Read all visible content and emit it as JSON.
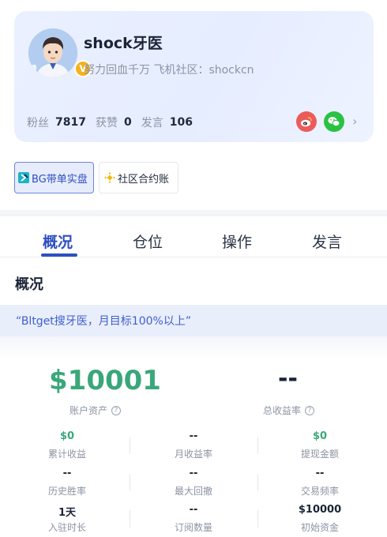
{
  "profile": {
    "username": "shock牙医",
    "bio": "努力回血千万 飞机社区：shockcn",
    "vip_badge": "V",
    "stats": [
      {
        "label": "粉丝",
        "value": "7817"
      },
      {
        "label": "获赞",
        "value": "0"
      },
      {
        "label": "发言",
        "value": "106"
      }
    ],
    "social_icons": [
      "weibo-icon",
      "wechat-icon"
    ]
  },
  "tags": {
    "bg_label": "BG带单实盘",
    "community_label": "社区合约账"
  },
  "tabs": [
    {
      "label": "概况",
      "active": true
    },
    {
      "label": "仓位",
      "active": false
    },
    {
      "label": "操作",
      "active": false
    },
    {
      "label": "发言",
      "active": false
    }
  ],
  "overview": {
    "title": "概况",
    "quote": "“Bltget搜牙医，月目标100%以上”",
    "account_asset_value": "$10001",
    "account_asset_label": "账户资产",
    "total_return_value": "--",
    "total_return_label": "总收益率",
    "metrics": [
      {
        "value": "$0",
        "label": "累计收益"
      },
      {
        "value": "--",
        "label": "月收益率"
      },
      {
        "value": "$0",
        "label": "提现金额"
      },
      {
        "value": "--",
        "label": "历史胜率"
      },
      {
        "value": "--",
        "label": "最大回撤"
      },
      {
        "value": "--",
        "label": "交易频率"
      },
      {
        "value": "1天",
        "label": "入驻时长"
      },
      {
        "value": "--",
        "label": "订阅数量"
      },
      {
        "value": "$10000",
        "label": "初始资金"
      }
    ]
  },
  "colors": {
    "accent": "#2d4fc0",
    "positive": "#3aa77a",
    "weibo": "#ec5b5b",
    "wechat": "#29c243"
  }
}
